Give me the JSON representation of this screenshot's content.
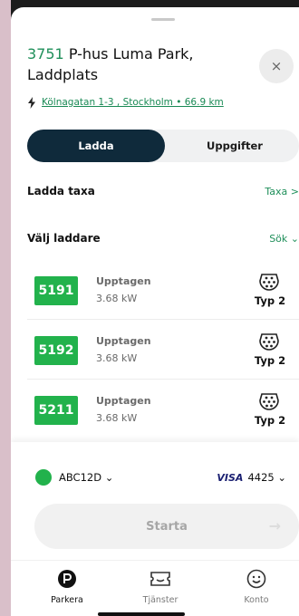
{
  "station": {
    "number": "3751",
    "name": "P-hus Luma Park, Laddplats",
    "address": "Kölnagatan 1-3 , Stockholm • 66.9 km"
  },
  "close_label": "×",
  "tabs": [
    {
      "label": "Ladda",
      "active": true
    },
    {
      "label": "Uppgifter",
      "active": false
    }
  ],
  "tariff": {
    "title": "Ladda taxa",
    "link": "Taxa >"
  },
  "chargers_header": {
    "title": "Välj laddare",
    "link": "Sök ⌄"
  },
  "chargers": [
    {
      "id": "5191",
      "status": "Upptagen",
      "power": "3.68 kW",
      "type": "Typ 2"
    },
    {
      "id": "5192",
      "status": "Upptagen",
      "power": "3.68 kW",
      "type": "Typ 2"
    },
    {
      "id": "5211",
      "status": "Upptagen",
      "power": "3.68 kW",
      "type": "Typ 2"
    }
  ],
  "vehicle": {
    "plate": "ABC12D ⌄"
  },
  "payment": {
    "brand": "VISA",
    "last4": "4425 ⌄"
  },
  "start_button": {
    "label": "Starta",
    "arrow": "→"
  },
  "nav": [
    {
      "label": "Parkera",
      "icon": "parking-icon",
      "active": true
    },
    {
      "label": "Tjänster",
      "icon": "ticket-icon",
      "active": false
    },
    {
      "label": "Konto",
      "icon": "smiley-icon",
      "active": false
    }
  ],
  "colors": {
    "accent_green": "#1f8f5a",
    "badge_green": "#22b24c",
    "tab_dark": "#0f2a3b"
  }
}
